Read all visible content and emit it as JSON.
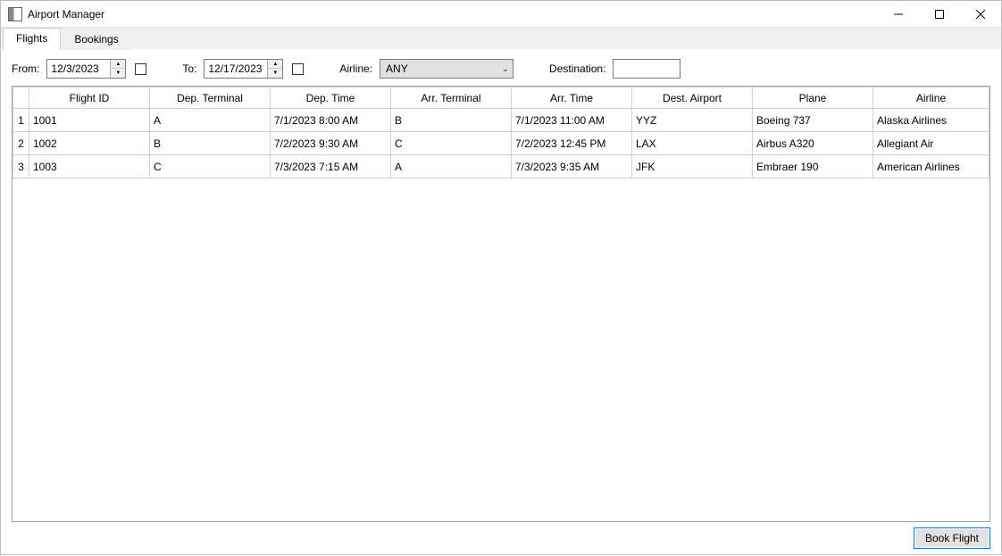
{
  "window": {
    "title": "Airport Manager"
  },
  "tabs": {
    "flights": "Flights",
    "bookings": "Bookings",
    "active": "flights"
  },
  "filters": {
    "from_label": "From:",
    "from_value": "12/3/2023",
    "to_label": "To:",
    "to_value": "12/17/2023",
    "airline_label": "Airline:",
    "airline_value": "ANY",
    "destination_label": "Destination:",
    "destination_value": ""
  },
  "columns": {
    "flight_id": "Flight ID",
    "dep_terminal": "Dep. Terminal",
    "dep_time": "Dep. Time",
    "arr_terminal": "Arr. Terminal",
    "arr_time": "Arr. Time",
    "dest_airport": "Dest. Airport",
    "plane": "Plane",
    "airline": "Airline"
  },
  "rows": [
    {
      "n": "1",
      "flight_id": "1001",
      "dep_terminal": "A",
      "dep_time": "7/1/2023 8:00 AM",
      "arr_terminal": "B",
      "arr_time": "7/1/2023 11:00 AM",
      "dest_airport": "YYZ",
      "plane": "Boeing 737",
      "airline": "Alaska Airlines"
    },
    {
      "n": "2",
      "flight_id": "1002",
      "dep_terminal": "B",
      "dep_time": "7/2/2023 9:30 AM",
      "arr_terminal": "C",
      "arr_time": "7/2/2023 12:45 PM",
      "dest_airport": "LAX",
      "plane": "Airbus A320",
      "airline": "Allegiant Air"
    },
    {
      "n": "3",
      "flight_id": "1003",
      "dep_terminal": "C",
      "dep_time": "7/3/2023 7:15 AM",
      "arr_terminal": "A",
      "arr_time": "7/3/2023 9:35 AM",
      "dest_airport": "JFK",
      "plane": "Embraer 190",
      "airline": "American Airlines"
    }
  ],
  "footer": {
    "book_button": "Book Flight"
  }
}
